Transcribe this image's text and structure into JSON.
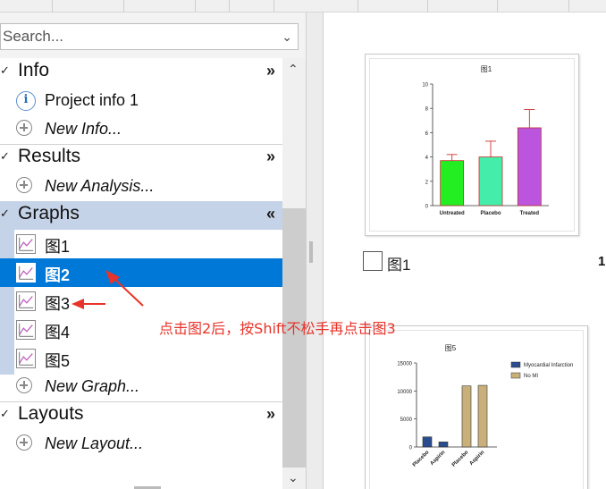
{
  "search": {
    "placeholder": "Search..."
  },
  "tree": {
    "info": {
      "label": "Info",
      "expand_glyph": "»",
      "items": [
        {
          "label": "Project info 1",
          "icon": "info-icon"
        },
        {
          "label": "New Info...",
          "icon": "add-icon"
        }
      ]
    },
    "results": {
      "label": "Results",
      "expand_glyph": "»",
      "items": [
        {
          "label": "New Analysis...",
          "icon": "add-icon"
        }
      ]
    },
    "graphs": {
      "label": "Graphs",
      "expand_glyph": "«",
      "items": [
        {
          "label": "图1",
          "icon": "graph-icon"
        },
        {
          "label": "图2",
          "icon": "graph-icon",
          "selected": true
        },
        {
          "label": "图3",
          "icon": "graph-icon"
        },
        {
          "label": "图4",
          "icon": "graph-icon"
        },
        {
          "label": "图5",
          "icon": "graph-icon"
        },
        {
          "label": "New Graph...",
          "icon": "add-icon"
        }
      ]
    },
    "layouts": {
      "label": "Layouts",
      "expand_glyph": "»",
      "items": [
        {
          "label": "New Layout...",
          "icon": "add-icon"
        }
      ]
    }
  },
  "annotation": {
    "text": "点击图2后，按Shift不松手再点击图3",
    "color": "#e8332a"
  },
  "gallery": {
    "thumb1": {
      "caption": "图1",
      "number": "1",
      "chart_data": {
        "type": "bar",
        "title": "图1",
        "categories": [
          "Untreated",
          "Placebo",
          "Treated"
        ],
        "values": [
          3.7,
          4.0,
          6.4
        ],
        "errors": [
          0.5,
          1.3,
          1.5
        ],
        "colors": [
          "#22ee22",
          "#44eeaa",
          "#bb55dd"
        ],
        "yticks": [
          0,
          2,
          4,
          6,
          8,
          10
        ],
        "ylim": [
          0,
          10
        ]
      }
    },
    "thumb2": {
      "chart_data": {
        "type": "bar",
        "title": "图5",
        "categories": [
          "Placebo",
          "Aspirin",
          "Placebo",
          "Aspirin"
        ],
        "values": [
          1800,
          900,
          10900,
          11000
        ],
        "series_of_bar": [
          0,
          0,
          1,
          1
        ],
        "series": [
          {
            "name": "Myocardial Infarction",
            "color": "#2a4d8f"
          },
          {
            "name": "No MI",
            "color": "#c9b07a"
          }
        ],
        "yticks": [
          0,
          5000,
          10000,
          15000
        ],
        "ytick_labels": [
          "0",
          "5000",
          "10000",
          "15000"
        ],
        "ylim": [
          0,
          15000
        ]
      }
    }
  }
}
